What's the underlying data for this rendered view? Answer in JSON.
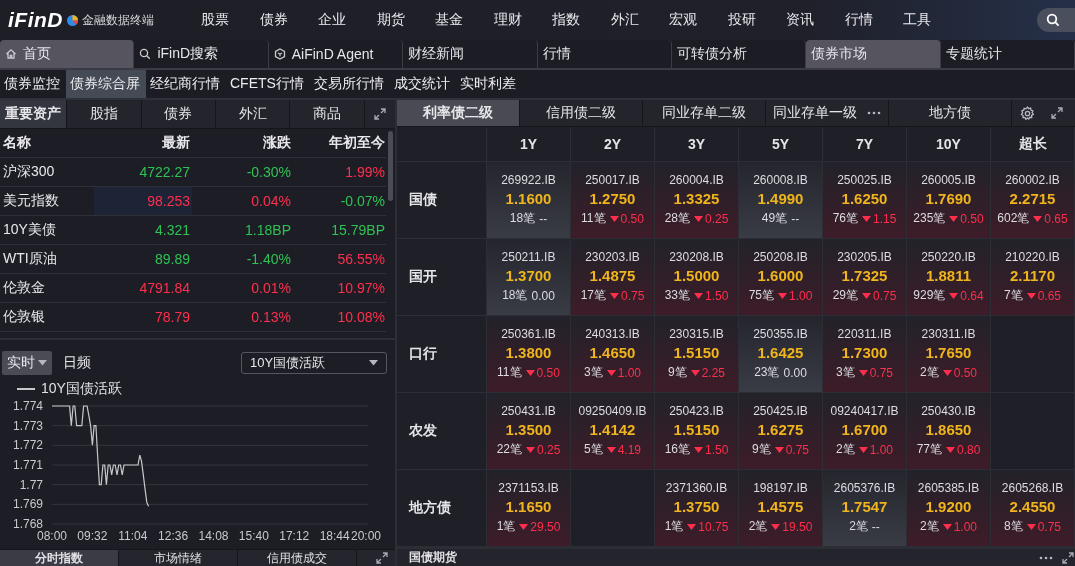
{
  "app": {
    "logo": "iFinD",
    "subtitle": "金融数据终端"
  },
  "nav": [
    "股票",
    "债券",
    "企业",
    "期货",
    "基金",
    "理财",
    "指数",
    "外汇",
    "宏观",
    "投研",
    "资讯",
    "行情",
    "工具"
  ],
  "tabs": [
    {
      "label": "首页",
      "kind": "home",
      "selected": true
    },
    {
      "label": "iFinD搜索",
      "kind": "search",
      "selected": false
    },
    {
      "label": "AiFinD Agent",
      "kind": "agent",
      "selected": false
    },
    {
      "label": "财经新闻",
      "kind": "plain",
      "selected": false
    },
    {
      "label": "行情",
      "kind": "plain",
      "selected": false
    },
    {
      "label": "可转债分析",
      "kind": "plain",
      "selected": false
    },
    {
      "label": "债券市场",
      "kind": "plain",
      "selected": true
    },
    {
      "label": "专题统计",
      "kind": "plain",
      "selected": false
    }
  ],
  "subnav": [
    {
      "label": "债券监控",
      "selected": false
    },
    {
      "label": "债券综合屏",
      "selected": true
    },
    {
      "label": "经纪商行情",
      "selected": false
    },
    {
      "label": "CFETS行情",
      "selected": false
    },
    {
      "label": "交易所行情",
      "selected": false
    },
    {
      "label": "成交统计",
      "selected": false
    },
    {
      "label": "实时利差",
      "selected": false
    }
  ],
  "assets": {
    "tabs": [
      {
        "label": "重要资产",
        "selected": true
      },
      {
        "label": "股指",
        "selected": false
      },
      {
        "label": "债券",
        "selected": false
      },
      {
        "label": "外汇",
        "selected": false
      },
      {
        "label": "商品",
        "selected": false
      }
    ],
    "table": {
      "columns": [
        "名称",
        "最新",
        "涨跌",
        "年初至今"
      ],
      "rows": [
        {
          "cells": [
            {
              "text": "沪深300"
            },
            {
              "text": "4722.27",
              "color": "#2ec254",
              "highlighted": false
            },
            {
              "text": "-0.30%",
              "color": "#2ec254",
              "highlighted": false
            },
            {
              "text": "1.99%",
              "color": "#ff2e4d",
              "highlighted": false
            }
          ]
        },
        {
          "cells": [
            {
              "text": "美元指数"
            },
            {
              "text": "98.253",
              "color": "#ff2e4d",
              "highlighted": true
            },
            {
              "text": "0.04%",
              "color": "#ff2e4d",
              "highlighted": false
            },
            {
              "text": "-0.07%",
              "color": "#2ec254",
              "highlighted": false
            }
          ]
        },
        {
          "cells": [
            {
              "text": "10Y美债"
            },
            {
              "text": "4.321",
              "color": "#2ec254",
              "highlighted": false
            },
            {
              "text": "1.18BP",
              "color": "#2ec254",
              "highlighted": false
            },
            {
              "text": "15.79BP",
              "color": "#2ec254",
              "highlighted": false
            }
          ]
        },
        {
          "cells": [
            {
              "text": "WTI原油"
            },
            {
              "text": "89.89",
              "color": "#2ec254",
              "highlighted": false
            },
            {
              "text": "-1.40%",
              "color": "#2ec254",
              "highlighted": false
            },
            {
              "text": "56.55%",
              "color": "#ff2e4d",
              "highlighted": false
            }
          ]
        },
        {
          "cells": [
            {
              "text": "伦敦金"
            },
            {
              "text": "4791.84",
              "color": "#ff2e4d",
              "highlighted": false
            },
            {
              "text": "0.01%",
              "color": "#ff2e4d",
              "highlighted": false
            },
            {
              "text": "10.97%",
              "color": "#ff2e4d",
              "highlighted": false
            }
          ]
        },
        {
          "cells": [
            {
              "text": "伦敦银"
            },
            {
              "text": "78.79",
              "color": "#ff2e4d",
              "highlighted": false
            },
            {
              "text": "0.13%",
              "color": "#ff2e4d",
              "highlighted": false
            },
            {
              "text": "10.08%",
              "color": "#ff2e4d",
              "highlighted": false
            }
          ]
        }
      ]
    },
    "modes": [
      {
        "label": "实时",
        "selected": true,
        "dropdown": true
      },
      {
        "label": "日频",
        "selected": false,
        "dropdown": false
      }
    ],
    "series_select": "10Y国债活跃",
    "chart_data": {
      "type": "line",
      "categories": [
        "08:00",
        null,
        null,
        null,
        null,
        null,
        null,
        null,
        null,
        null,
        null,
        null,
        null,
        null,
        null,
        null,
        null,
        null,
        null,
        null,
        null,
        null,
        null,
        "09:32",
        null,
        null,
        null,
        null,
        null,
        null,
        null,
        null,
        null,
        null,
        null,
        null,
        null,
        null,
        null,
        null,
        null,
        null,
        null,
        null,
        null,
        null,
        "11:04",
        null,
        null,
        null,
        null,
        null,
        null,
        null,
        null,
        null,
        null,
        null,
        null,
        null,
        null,
        null,
        null,
        null,
        null,
        null,
        null,
        null,
        null,
        "12:36",
        null,
        null,
        null,
        null,
        null,
        null,
        null,
        null,
        null,
        null,
        null,
        null,
        null,
        null,
        null,
        null,
        null,
        null,
        null,
        null,
        null,
        null,
        "14:08",
        null,
        null,
        null,
        null,
        null,
        null,
        null,
        null,
        null,
        null,
        null,
        null,
        null,
        null,
        null,
        null,
        null,
        null,
        null,
        null,
        null,
        null,
        "15:40",
        null,
        null,
        null,
        null,
        null,
        null,
        null,
        null,
        null,
        null,
        null,
        null,
        null,
        null,
        null,
        null,
        null,
        null,
        null,
        null,
        null,
        null,
        "17:12",
        null,
        null,
        null,
        null,
        null,
        null,
        null,
        null,
        null,
        null,
        null,
        null,
        null,
        null,
        null,
        null,
        null,
        null,
        null,
        null,
        null,
        null,
        "18:44",
        null,
        null,
        null,
        null,
        null,
        null,
        null,
        null,
        null,
        null,
        null,
        null,
        null,
        null,
        null,
        null,
        null,
        null,
        "20:00"
      ],
      "series": [
        {
          "name": "10Y国债活跃",
          "color": "#c8c8cc",
          "values": [
            1.774,
            1.774,
            1.774,
            1.774,
            1.774,
            1.774,
            1.774,
            1.774,
            1.774,
            1.774,
            1.774,
            1.773,
            1.774,
            1.774,
            1.773,
            1.773,
            1.773,
            1.773,
            1.774,
            1.774,
            1.774,
            1.7735,
            1.773,
            1.772,
            1.773,
            1.773,
            1.7715,
            1.77,
            1.77,
            1.771,
            1.771,
            1.77,
            1.771,
            1.771,
            1.7705,
            1.771,
            1.771,
            1.7705,
            1.771,
            1.771,
            1.7705,
            1.771,
            1.771,
            1.771,
            1.771,
            1.771,
            1.771,
            1.771,
            1.771,
            1.771,
            1.7715,
            1.7712,
            1.7705,
            1.7698,
            1.7691,
            1.7689,
            null,
            null,
            null,
            null,
            null,
            null,
            null,
            null,
            null,
            null,
            null,
            null,
            null,
            null,
            null,
            null,
            null,
            null,
            null,
            null,
            null,
            null,
            null,
            null,
            null,
            null,
            null,
            null,
            null,
            null,
            null,
            null,
            null,
            null,
            null,
            null,
            null,
            null,
            null,
            null,
            null,
            null,
            null,
            null,
            null,
            null,
            null,
            null,
            null,
            null,
            null,
            null,
            null,
            null,
            null,
            null,
            null,
            null,
            null,
            null,
            null,
            null,
            null,
            null,
            null,
            null,
            null,
            null,
            null,
            null,
            null,
            null,
            null,
            null,
            null,
            null,
            null,
            null,
            null,
            null,
            null,
            null,
            null,
            null,
            null,
            null,
            null,
            null,
            null,
            null,
            null,
            null,
            null,
            null,
            null,
            null,
            null,
            null,
            null,
            null,
            null,
            null,
            null,
            null,
            null,
            null,
            null,
            null,
            null,
            null,
            null,
            null,
            null,
            null,
            null,
            null,
            null,
            null,
            null,
            null,
            null,
            null,
            null,
            null,
            null
          ]
        }
      ],
      "ylim": [
        1.768,
        1.774
      ],
      "grid": true,
      "yticks": [
        1.768,
        1.769,
        1.77,
        1.771,
        1.772,
        1.773,
        1.774
      ]
    },
    "bottom_tabs": [
      {
        "label": "分时指数",
        "selected": true
      },
      {
        "label": "市场情绪",
        "selected": false
      },
      {
        "label": "信用债成交",
        "selected": false
      }
    ]
  },
  "bonds": {
    "tabs": [
      {
        "label": "利率债二级",
        "selected": true
      },
      {
        "label": "信用债二级",
        "selected": false
      },
      {
        "label": "同业存单二级",
        "selected": false
      },
      {
        "label": "同业存单一级",
        "selected": false
      },
      {
        "label": "地方债",
        "selected": false
      }
    ],
    "columns": [
      "1Y",
      "2Y",
      "3Y",
      "5Y",
      "7Y",
      "10Y",
      "超长"
    ],
    "rows": [
      {
        "label": "国债",
        "cells": [
          {
            "kind": "flat",
            "code": "269922.IB",
            "yield": "1.1600",
            "count": "18笔",
            "change": "--"
          },
          {
            "kind": "down",
            "code": "250017.IB",
            "yield": "1.2750",
            "count": "11笔",
            "change": "0.50"
          },
          {
            "kind": "down",
            "code": "260004.IB",
            "yield": "1.3325",
            "count": "28笔",
            "change": "0.25"
          },
          {
            "kind": "flat",
            "code": "260008.IB",
            "yield": "1.4990",
            "count": "49笔",
            "change": "--"
          },
          {
            "kind": "down",
            "code": "250025.IB",
            "yield": "1.6250",
            "count": "76笔",
            "change": "1.15"
          },
          {
            "kind": "down",
            "code": "260005.IB",
            "yield": "1.7690",
            "count": "235笔",
            "change": "0.50"
          },
          {
            "kind": "down",
            "code": "260002.IB",
            "yield": "2.2715",
            "count": "602笔",
            "change": "0.65"
          }
        ]
      },
      {
        "label": "国开",
        "cells": [
          {
            "kind": "flat",
            "code": "250211.IB",
            "yield": "1.3700",
            "count": "18笔",
            "change": "0.00"
          },
          {
            "kind": "down",
            "code": "230203.IB",
            "yield": "1.4875",
            "count": "17笔",
            "change": "0.75"
          },
          {
            "kind": "down",
            "code": "230208.IB",
            "yield": "1.5000",
            "count": "33笔",
            "change": "1.50"
          },
          {
            "kind": "down",
            "code": "250208.IB",
            "yield": "1.6000",
            "count": "75笔",
            "change": "1.00"
          },
          {
            "kind": "down",
            "code": "230205.IB",
            "yield": "1.7325",
            "count": "29笔",
            "change": "0.75"
          },
          {
            "kind": "down",
            "code": "250220.IB",
            "yield": "1.8811",
            "count": "929笔",
            "change": "0.64"
          },
          {
            "kind": "down",
            "code": "210220.IB",
            "yield": "2.1170",
            "count": "7笔",
            "change": "0.65"
          }
        ]
      },
      {
        "label": "口行",
        "cells": [
          {
            "kind": "down",
            "code": "250361.IB",
            "yield": "1.3800",
            "count": "11笔",
            "change": "0.50"
          },
          {
            "kind": "down",
            "code": "240313.IB",
            "yield": "1.4650",
            "count": "3笔",
            "change": "1.00"
          },
          {
            "kind": "down",
            "code": "230315.IB",
            "yield": "1.5150",
            "count": "9笔",
            "change": "2.25"
          },
          {
            "kind": "flat",
            "code": "250355.IB",
            "yield": "1.6425",
            "count": "23笔",
            "change": "0.00"
          },
          {
            "kind": "down",
            "code": "220311.IB",
            "yield": "1.7300",
            "count": "3笔",
            "change": "0.75"
          },
          {
            "kind": "down",
            "code": "230311.IB",
            "yield": "1.7650",
            "count": "2笔",
            "change": "0.50"
          },
          {
            "kind": "empty"
          }
        ]
      },
      {
        "label": "农发",
        "cells": [
          {
            "kind": "down",
            "code": "250431.IB",
            "yield": "1.3500",
            "count": "22笔",
            "change": "0.25"
          },
          {
            "kind": "down",
            "code": "09250409.IB",
            "yield": "1.4142",
            "count": "5笔",
            "change": "4.19"
          },
          {
            "kind": "down",
            "code": "250423.IB",
            "yield": "1.5150",
            "count": "16笔",
            "change": "1.50"
          },
          {
            "kind": "down",
            "code": "250425.IB",
            "yield": "1.6275",
            "count": "9笔",
            "change": "0.75"
          },
          {
            "kind": "down",
            "code": "09240417.IB",
            "yield": "1.6700",
            "count": "2笔",
            "change": "1.00"
          },
          {
            "kind": "down",
            "code": "250430.IB",
            "yield": "1.8650",
            "count": "77笔",
            "change": "0.80"
          },
          {
            "kind": "empty"
          }
        ]
      },
      {
        "label": "地方债",
        "cells": [
          {
            "kind": "down",
            "code": "2371153.IB",
            "yield": "1.1650",
            "count": "1笔",
            "change": "29.50"
          },
          {
            "kind": "empty"
          },
          {
            "kind": "down",
            "code": "2371360.IB",
            "yield": "1.3750",
            "count": "1笔",
            "change": "10.75"
          },
          {
            "kind": "down",
            "code": "198197.IB",
            "yield": "1.4575",
            "count": "2笔",
            "change": "19.50"
          },
          {
            "kind": "flat",
            "code": "2605376.IB",
            "yield": "1.7547",
            "count": "2笔",
            "change": "--"
          },
          {
            "kind": "down",
            "code": "2605385.IB",
            "yield": "1.9200",
            "count": "2笔",
            "change": "1.00"
          },
          {
            "kind": "down",
            "code": "2605268.IB",
            "yield": "2.4550",
            "count": "8笔",
            "change": "0.75"
          }
        ]
      }
    ]
  },
  "futures": {
    "title": "国债期货"
  }
}
